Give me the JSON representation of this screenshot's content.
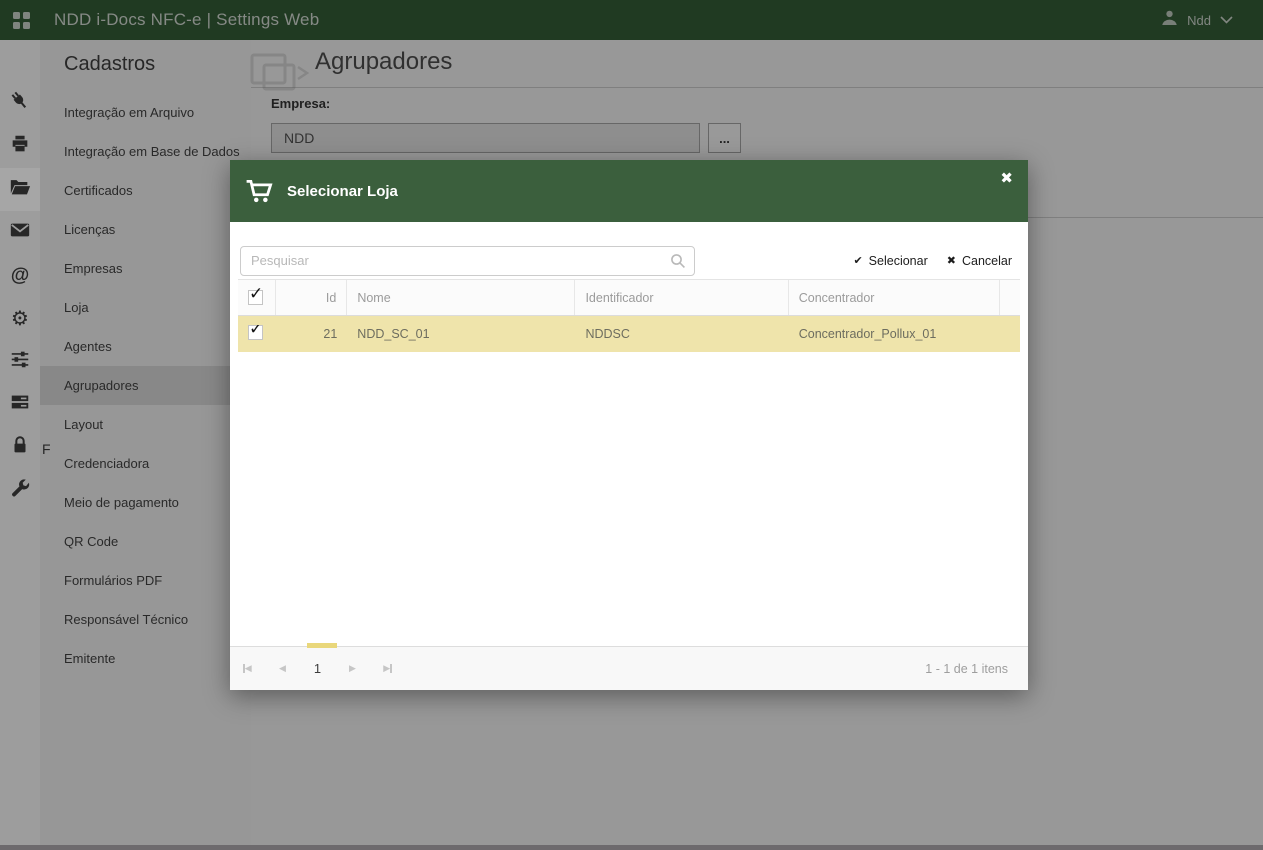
{
  "topbar": {
    "title": "NDD i-Docs NFC-e | Settings Web",
    "user_name": "Ndd"
  },
  "iconbar": {
    "icons": [
      "plug-icon",
      "printer-icon",
      "folder-open-icon",
      "mail-icon",
      "at-icon",
      "gear-icon",
      "sliders-icon",
      "server-icon",
      "lock-icon",
      "wrench-icon"
    ],
    "active_icon": "folder-open-icon",
    "at_glyph": "@",
    "gear_glyph": "⚙"
  },
  "sidebar": {
    "title": "Cadastros",
    "items": [
      "Integração em Arquivo",
      "Integração em Base de Dados",
      "Certificados",
      "Licenças",
      "Empresas",
      "Loja",
      "Agentes",
      "Agrupadores",
      "Layout",
      "Credenciadora",
      "Meio de pagamento",
      "QR Code",
      "Formulários PDF",
      "Responsável Técnico",
      "Emitente"
    ],
    "active_index": 7,
    "stray_text": "F"
  },
  "page": {
    "title": "Agrupadores",
    "empresa_label": "Empresa:",
    "empresa_value": "NDD",
    "browse_label": "..."
  },
  "modal": {
    "title": "Selecionar Loja",
    "close_glyph": "✖",
    "search_placeholder": "Pesquisar",
    "select_label": "Selecionar",
    "select_glyph": "✔",
    "cancel_label": "Cancelar",
    "cancel_glyph": "✖",
    "checkbox_glyph": "✓",
    "table": {
      "columns": [
        "Id",
        "Nome",
        "Identificador",
        "Concentrador"
      ],
      "rows": [
        {
          "id": "21",
          "nome": "NDD_SC_01",
          "identificador": "NDDSC",
          "concentrador": "Concentrador_Pollux_01",
          "selected": true
        }
      ]
    },
    "pager": {
      "page": "1",
      "info": "1 - 1 de 1 itens"
    }
  },
  "colors": {
    "topbar_green": "#325a35",
    "modal_green": "#3b5f3d",
    "row_highlight": "#efe4ab",
    "page_indicator": "#e9d77b"
  }
}
